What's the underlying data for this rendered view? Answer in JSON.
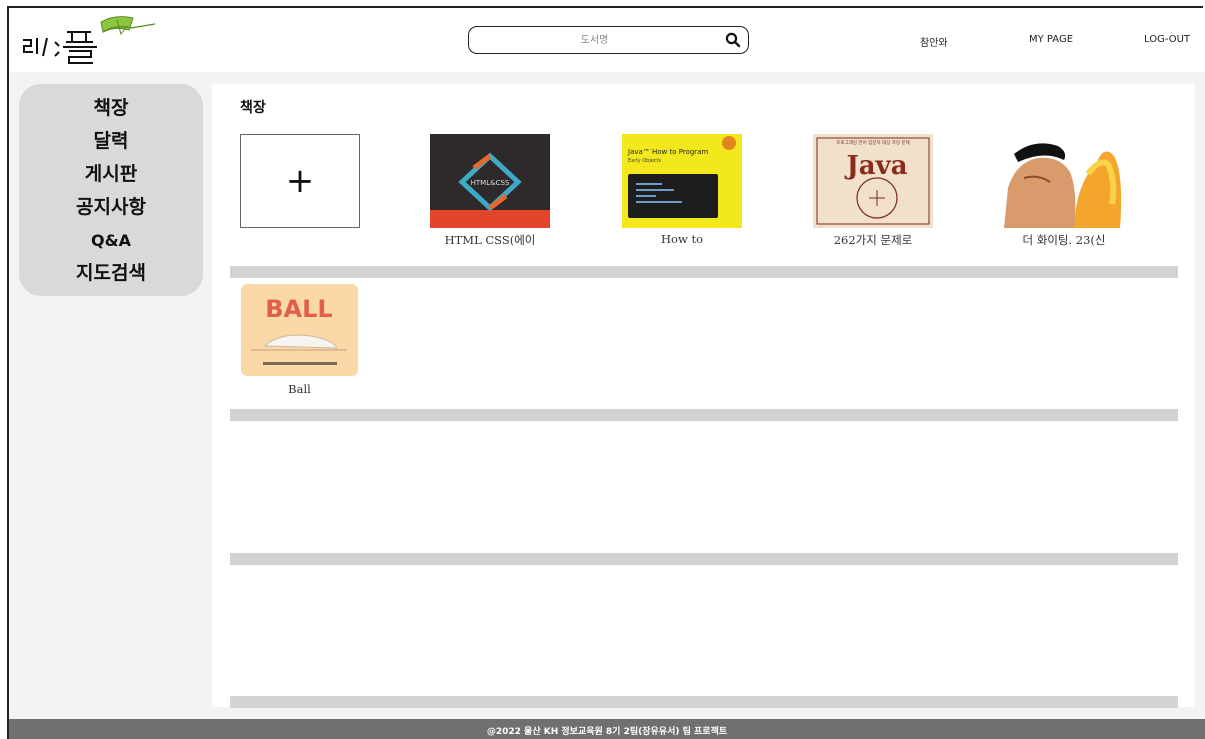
{
  "header": {
    "logo_text": "리:플",
    "search_placeholder": "도서명",
    "nav": {
      "user": "참안와",
      "mypage": "MY PAGE",
      "logout": "LOG-OUT"
    }
  },
  "sidebar": {
    "items": [
      {
        "label": "책장"
      },
      {
        "label": "달력"
      },
      {
        "label": "게시판"
      },
      {
        "label": "공지사항"
      },
      {
        "label": "Q&A"
      },
      {
        "label": "지도검색"
      }
    ]
  },
  "main": {
    "title": "책장",
    "add_label": "+",
    "books": [
      {
        "title": "HTML CSS(에이"
      },
      {
        "title": "How to"
      },
      {
        "title": "262가지 문제로"
      },
      {
        "title": "더 화이팅. 23(신"
      },
      {
        "title": "Ball"
      }
    ],
    "covers": {
      "html_css": {
        "text": "HTML&CSS"
      },
      "java_how": {
        "line1": "Java™ How to Program",
        "line2": "Early Objects"
      },
      "java_262": {
        "top": "프로그래밍 언어 입문자 대상 코딩 문제",
        "big": "Java"
      },
      "ball": {
        "big": "BALL"
      }
    }
  },
  "footer": {
    "text": "@2022 울산 KH 정보교육원 8기 2팀(장유유서) 팀 프로젝트"
  },
  "colors": {
    "sidebar_bg": "#d9d9d9",
    "shelf_bar": "#d3d3d3",
    "footer_bg": "#707070",
    "page_bg": "#f3f3f3"
  }
}
